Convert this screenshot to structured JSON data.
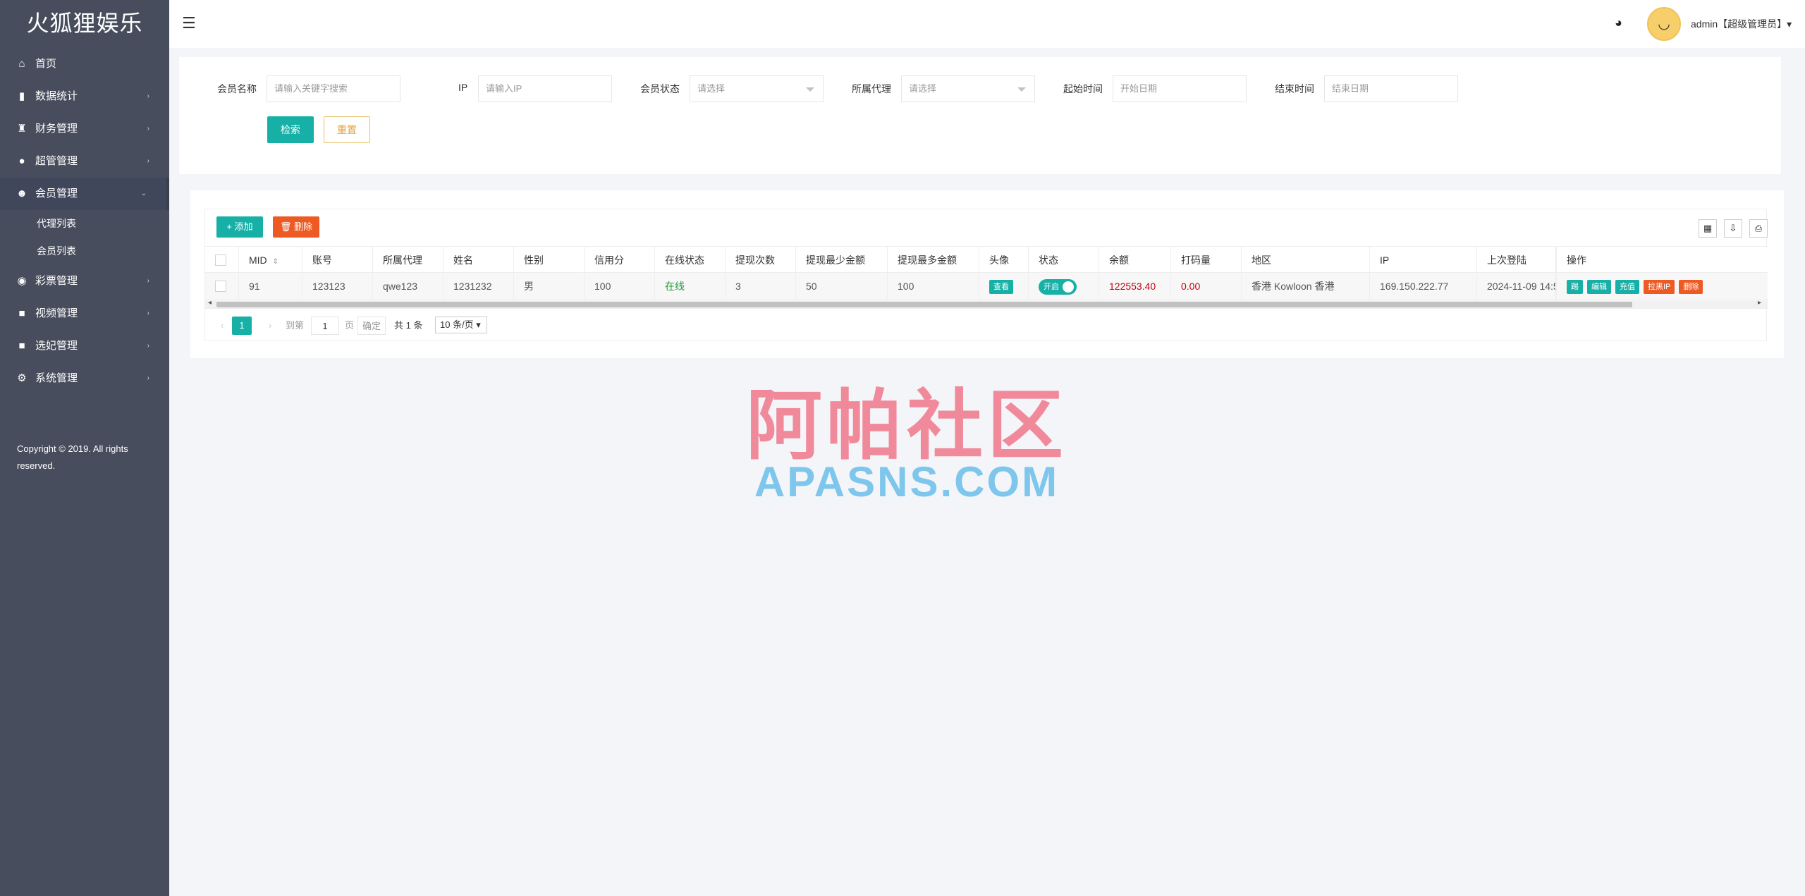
{
  "sidebar": {
    "logo": "火狐狸娱乐",
    "items": [
      {
        "label": "首页",
        "icon": "home-icon",
        "glyph": "⌂",
        "arrow": ""
      },
      {
        "label": "数据统计",
        "icon": "bar-chart-icon",
        "glyph": "▮",
        "arrow": "›"
      },
      {
        "label": "财务管理",
        "icon": "bank-icon",
        "glyph": "♜",
        "arrow": "›"
      },
      {
        "label": "超管管理",
        "icon": "user-icon",
        "glyph": "●",
        "arrow": "›"
      },
      {
        "label": "会员管理",
        "icon": "users-icon",
        "glyph": "☻",
        "arrow": "⌄"
      },
      {
        "label": "彩票管理",
        "icon": "gamepad-icon",
        "glyph": "◉",
        "arrow": "›"
      },
      {
        "label": "视频管理",
        "icon": "video-icon",
        "glyph": "■",
        "arrow": "›"
      },
      {
        "label": "选妃管理",
        "icon": "video-icon",
        "glyph": "■",
        "arrow": "›"
      },
      {
        "label": "系统管理",
        "icon": "gear-icon",
        "glyph": "⚙",
        "arrow": "›"
      }
    ],
    "sub_items": [
      "代理列表",
      "会员列表"
    ],
    "copyright": "Copyright © 2019. All rights reserved."
  },
  "header": {
    "menu_glyph": "☰",
    "theme_glyph": "◕",
    "avatar_glyph": "◡",
    "user": "admin【超级管理员】▾"
  },
  "search": {
    "member_name_label": "会员名称",
    "member_name_placeholder": "请输入关键字搜索",
    "ip_label": "IP",
    "ip_placeholder": "请输入IP",
    "status_label": "会员状态",
    "status_value": "请选择",
    "agent_label": "所属代理",
    "agent_value": "请选择",
    "start_label": "起始时间",
    "start_placeholder": "开始日期",
    "end_label": "结束时间",
    "end_placeholder": "结束日期",
    "search_button": "检索",
    "reset_button": "重置"
  },
  "toolbar": {
    "add": "+ 添加",
    "delete": "🗑 删除",
    "tools": [
      "▦",
      "⇩",
      "⎙"
    ]
  },
  "table": {
    "headers": [
      "MID",
      "账号",
      "所属代理",
      "姓名",
      "性别",
      "信用分",
      "在线状态",
      "提现次数",
      "提现最少金额",
      "提现最多金额",
      "头像",
      "状态",
      "余额",
      "打码量",
      "地区",
      "IP",
      "上次登陆",
      "操作"
    ],
    "sort_glyph": "⇕",
    "row": {
      "mid": "91",
      "account": "123123",
      "agent": "qwe123",
      "name": "1231232",
      "gender": "男",
      "credit": "100",
      "online": "在线",
      "withdraw_count": "3",
      "min_withdraw": "50",
      "max_withdraw": "100",
      "avatar_btn": "查看",
      "status_switch": "开启",
      "balance": "122553.40",
      "bet_amount": "0.00",
      "region": "香港 Kowloon 香港",
      "ip": "169.150.222.77",
      "last_login": "2024-11-09 14:5",
      "actions": [
        "踢",
        "编辑",
        "充值",
        "拉黑IP",
        "删除"
      ]
    }
  },
  "pager": {
    "prev": "‹",
    "current": "1",
    "next": "›",
    "goto_label": "到第",
    "goto_value": "1",
    "page_unit": "页",
    "confirm": "确定",
    "total": "共 1 条",
    "page_size": "10 条/页 ▾"
  },
  "watermark": {
    "cn": "阿帕社区",
    "en": "APASNS.COM"
  },
  "colors": {
    "sidebar_bg": "#474d5c",
    "primary": "#16b0a6",
    "danger": "#ee5a24",
    "warning": "#e6a23c"
  }
}
